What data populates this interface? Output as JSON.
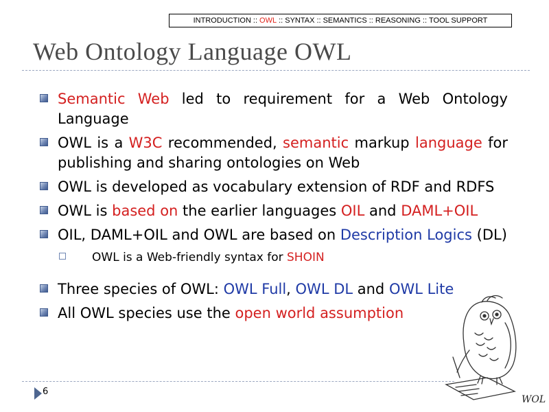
{
  "nav": {
    "items": [
      "INTRODUCTION",
      "OWL",
      "SYNTAX",
      "SEMANTICS",
      "REASONING",
      "TOOL SUPPORT"
    ],
    "separator": "::",
    "active": "OWL",
    "active_color": "#e0241a"
  },
  "title": "Web Ontology Language OWL",
  "bullets": [
    {
      "parts": [
        {
          "text": "Semantic Web",
          "style": "red"
        },
        {
          "text": " led to requirement for a Web Ontology Language",
          "style": "plain"
        }
      ]
    },
    {
      "parts": [
        {
          "text": "OWL is a ",
          "style": "plain"
        },
        {
          "text": "W3C",
          "style": "red"
        },
        {
          "text": " recommended, ",
          "style": "plain"
        },
        {
          "text": "semantic",
          "style": "red"
        },
        {
          "text": " markup ",
          "style": "plain"
        },
        {
          "text": "language",
          "style": "red"
        },
        {
          "text": " for publishing and sharing ontologies on Web",
          "style": "plain"
        }
      ]
    },
    {
      "parts": [
        {
          "text": "OWL is developed as vocabulary extension of RDF and RDFS",
          "style": "plain"
        }
      ]
    },
    {
      "parts": [
        {
          "text": "OWL is ",
          "style": "plain"
        },
        {
          "text": "based on",
          "style": "red"
        },
        {
          "text": " the earlier languages ",
          "style": "plain"
        },
        {
          "text": "OIL",
          "style": "red"
        },
        {
          "text": " and ",
          "style": "plain"
        },
        {
          "text": "DAML+OIL",
          "style": "red"
        }
      ]
    },
    {
      "parts": [
        {
          "text": "OIL, DAML+OIL and OWL are based on ",
          "style": "plain"
        },
        {
          "text": "Description Logics",
          "style": "blue"
        },
        {
          "text": " (DL)",
          "style": "plain"
        }
      ],
      "sub": {
        "parts": [
          {
            "text": "OWL is a Web-friendly syntax for ",
            "style": "plain"
          },
          {
            "text": "SHOIN",
            "style": "red"
          }
        ]
      }
    },
    {
      "parts": [
        {
          "text": "Three species of OWL: ",
          "style": "plain"
        },
        {
          "text": "OWL Full",
          "style": "blue"
        },
        {
          "text": ", ",
          "style": "plain"
        },
        {
          "text": "OWL DL",
          "style": "blue"
        },
        {
          "text": " and ",
          "style": "plain"
        },
        {
          "text": "OWL Lite",
          "style": "blue"
        }
      ]
    },
    {
      "parts": [
        {
          "text": "All OWL species use the ",
          "style": "plain"
        },
        {
          "text": "open world assumption",
          "style": "red"
        }
      ]
    }
  ],
  "page_number": "6",
  "owl_caption": "WOL",
  "colors": {
    "red": "#d42020",
    "blue": "#1f3aa6",
    "title": "#4a4a4a",
    "bullet": "#6f86b3"
  }
}
